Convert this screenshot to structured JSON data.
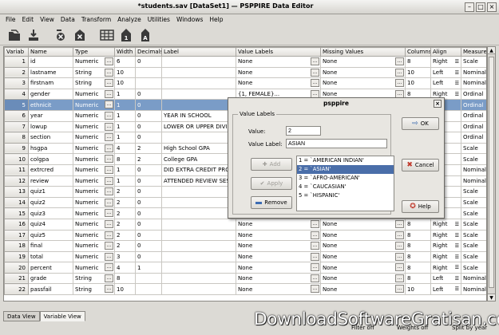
{
  "window": {
    "title": "*students.sav [DataSet1] — PSPPIRE Data Editor"
  },
  "menu": [
    "File",
    "Edit",
    "View",
    "Data",
    "Transform",
    "Analyze",
    "Utilities",
    "Windows",
    "Help"
  ],
  "toolbar_icons": [
    "open-icon",
    "save-icon",
    "goto-case-icon",
    "goto-variable-icon",
    "insert-variable-icon",
    "value-labels-icon",
    "weight-icon"
  ],
  "grid": {
    "columns": [
      "Variab",
      "Name",
      "Type",
      "Width",
      "Decimals",
      "Label",
      "Value Labels",
      "Missing Values",
      "Columns",
      "Align",
      "Measure"
    ],
    "rows": [
      {
        "n": "1",
        "name": "id",
        "type": "Numeric",
        "width": "6",
        "dec": "0",
        "label": "",
        "vlab": "None",
        "miss": "None",
        "cols": "8",
        "align": "Right",
        "meas": "Scale"
      },
      {
        "n": "2",
        "name": "lastname",
        "type": "String",
        "width": "10",
        "dec": "",
        "label": "",
        "vlab": "None",
        "miss": "None",
        "cols": "10",
        "align": "Left",
        "meas": "Nominal"
      },
      {
        "n": "3",
        "name": "firstnam",
        "type": "String",
        "width": "10",
        "dec": "",
        "label": "",
        "vlab": "None",
        "miss": "None",
        "cols": "10",
        "align": "Left",
        "meas": "Nominal"
      },
      {
        "n": "4",
        "name": "gender",
        "type": "Numeric",
        "width": "1",
        "dec": "0",
        "label": "",
        "vlab": "{1, FEMALE}...",
        "miss": "None",
        "cols": "8",
        "align": "Right",
        "meas": "Ordinal"
      },
      {
        "n": "5",
        "name": "ethnicit",
        "type": "Numeric",
        "width": "1",
        "dec": "0",
        "label": "",
        "vlab": "",
        "miss": "",
        "cols": "",
        "align": "",
        "meas": "Ordinal",
        "selected": true
      },
      {
        "n": "6",
        "name": "year",
        "type": "Numeric",
        "width": "1",
        "dec": "0",
        "label": "YEAR IN SCHOOL",
        "vlab": "",
        "miss": "",
        "cols": "",
        "align": "",
        "meas": "Ordinal"
      },
      {
        "n": "7",
        "name": "lowup",
        "type": "Numeric",
        "width": "1",
        "dec": "0",
        "label": "LOWER OR UPPER DIVIS",
        "vlab": "",
        "miss": "",
        "cols": "",
        "align": "",
        "meas": "Ordinal"
      },
      {
        "n": "8",
        "name": "section",
        "type": "Numeric",
        "width": "1",
        "dec": "0",
        "label": "",
        "vlab": "",
        "miss": "",
        "cols": "",
        "align": "",
        "meas": "Ordinal"
      },
      {
        "n": "9",
        "name": "hsgpa",
        "type": "Numeric",
        "width": "4",
        "dec": "2",
        "label": "High School GPA",
        "vlab": "",
        "miss": "",
        "cols": "",
        "align": "",
        "meas": "Scale"
      },
      {
        "n": "10",
        "name": "colgpa",
        "type": "Numeric",
        "width": "8",
        "dec": "2",
        "label": "College GPA",
        "vlab": "",
        "miss": "",
        "cols": "",
        "align": "",
        "meas": "Scale"
      },
      {
        "n": "11",
        "name": "extrcred",
        "type": "Numeric",
        "width": "1",
        "dec": "0",
        "label": "DID EXTRA CREDIT PRO",
        "vlab": "",
        "miss": "",
        "cols": "",
        "align": "",
        "meas": "Nominal"
      },
      {
        "n": "12",
        "name": "review",
        "type": "Numeric",
        "width": "1",
        "dec": "0",
        "label": "ATTENDED REVIEW SES",
        "vlab": "",
        "miss": "",
        "cols": "",
        "align": "",
        "meas": "Nominal"
      },
      {
        "n": "13",
        "name": "quiz1",
        "type": "Numeric",
        "width": "2",
        "dec": "0",
        "label": "",
        "vlab": "",
        "miss": "",
        "cols": "",
        "align": "",
        "meas": "Scale"
      },
      {
        "n": "14",
        "name": "quiz2",
        "type": "Numeric",
        "width": "2",
        "dec": "0",
        "label": "",
        "vlab": "",
        "miss": "",
        "cols": "",
        "align": "",
        "meas": "Scale"
      },
      {
        "n": "15",
        "name": "quiz3",
        "type": "Numeric",
        "width": "2",
        "dec": "0",
        "label": "",
        "vlab": "",
        "miss": "",
        "cols": "",
        "align": "",
        "meas": "Scale"
      },
      {
        "n": "16",
        "name": "quiz4",
        "type": "Numeric",
        "width": "2",
        "dec": "0",
        "label": "",
        "vlab": "None",
        "miss": "None",
        "cols": "8",
        "align": "Right",
        "meas": "Scale"
      },
      {
        "n": "17",
        "name": "quiz5",
        "type": "Numeric",
        "width": "2",
        "dec": "0",
        "label": "",
        "vlab": "None",
        "miss": "None",
        "cols": "8",
        "align": "Right",
        "meas": "Scale"
      },
      {
        "n": "18",
        "name": "final",
        "type": "Numeric",
        "width": "2",
        "dec": "0",
        "label": "",
        "vlab": "None",
        "miss": "None",
        "cols": "8",
        "align": "Right",
        "meas": "Scale"
      },
      {
        "n": "19",
        "name": "total",
        "type": "Numeric",
        "width": "3",
        "dec": "0",
        "label": "",
        "vlab": "None",
        "miss": "None",
        "cols": "8",
        "align": "Right",
        "meas": "Scale"
      },
      {
        "n": "20",
        "name": "percent",
        "type": "Numeric",
        "width": "4",
        "dec": "1",
        "label": "",
        "vlab": "None",
        "miss": "None",
        "cols": "8",
        "align": "Right",
        "meas": "Scale"
      },
      {
        "n": "21",
        "name": "grade",
        "type": "String",
        "width": "8",
        "dec": "",
        "label": "",
        "vlab": "None",
        "miss": "None",
        "cols": "8",
        "align": "Left",
        "meas": "Nominal"
      },
      {
        "n": "22",
        "name": "passfail",
        "type": "String",
        "width": "10",
        "dec": "",
        "label": "",
        "vlab": "None",
        "miss": "None",
        "cols": "10",
        "align": "Left",
        "meas": "Nominal"
      }
    ]
  },
  "tabs": [
    "Data View",
    "Variable View"
  ],
  "status": {
    "filter": "Filter off",
    "weights": "Weights off",
    "split": "Split by year"
  },
  "watermark": "DownloadSoftwareGratisan.com",
  "dialog": {
    "title": "psppire",
    "frame_label": "Value Labels",
    "value_label": "Value:",
    "value": "2",
    "value_label_label": "Value Label:",
    "value_label_value": "ASIAN",
    "add": "Add",
    "apply": "Apply",
    "remove": "Remove",
    "ok": "OK",
    "cancel": "Cancel",
    "help": "Help",
    "labels": [
      "1 = `AMERICAN INDIAN'",
      "2 = `ASIAN'",
      "3 = `AFRO-AMERICAN'",
      "4 = `CAUCASIAN'",
      "5 = `HISPANIC'"
    ],
    "selected_index": 1
  }
}
